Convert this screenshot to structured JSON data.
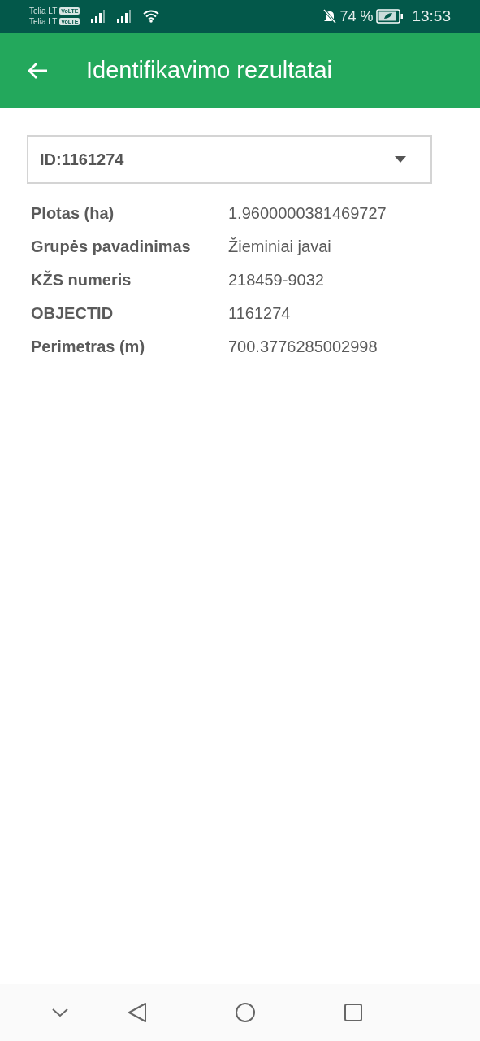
{
  "status_bar": {
    "carriers": [
      {
        "name": "Telia LT",
        "badge": "VoLTE"
      },
      {
        "name": "Telia LT",
        "badge": "VoLTE"
      }
    ],
    "battery": "74 %",
    "time": "13:53"
  },
  "app_bar": {
    "title": "Identifikavimo rezultatai"
  },
  "dropdown": {
    "value": "ID:1161274"
  },
  "attributes": [
    {
      "label": "Plotas (ha)",
      "value": "1.9600000381469727"
    },
    {
      "label": "Grupės pavadinimas",
      "value": "Žieminiai javai"
    },
    {
      "label": "KŽS numeris",
      "value": "218459-9032"
    },
    {
      "label": "OBJECTID",
      "value": "1161274"
    },
    {
      "label": "Perimetras (m)",
      "value": "700.3776285002998"
    }
  ]
}
